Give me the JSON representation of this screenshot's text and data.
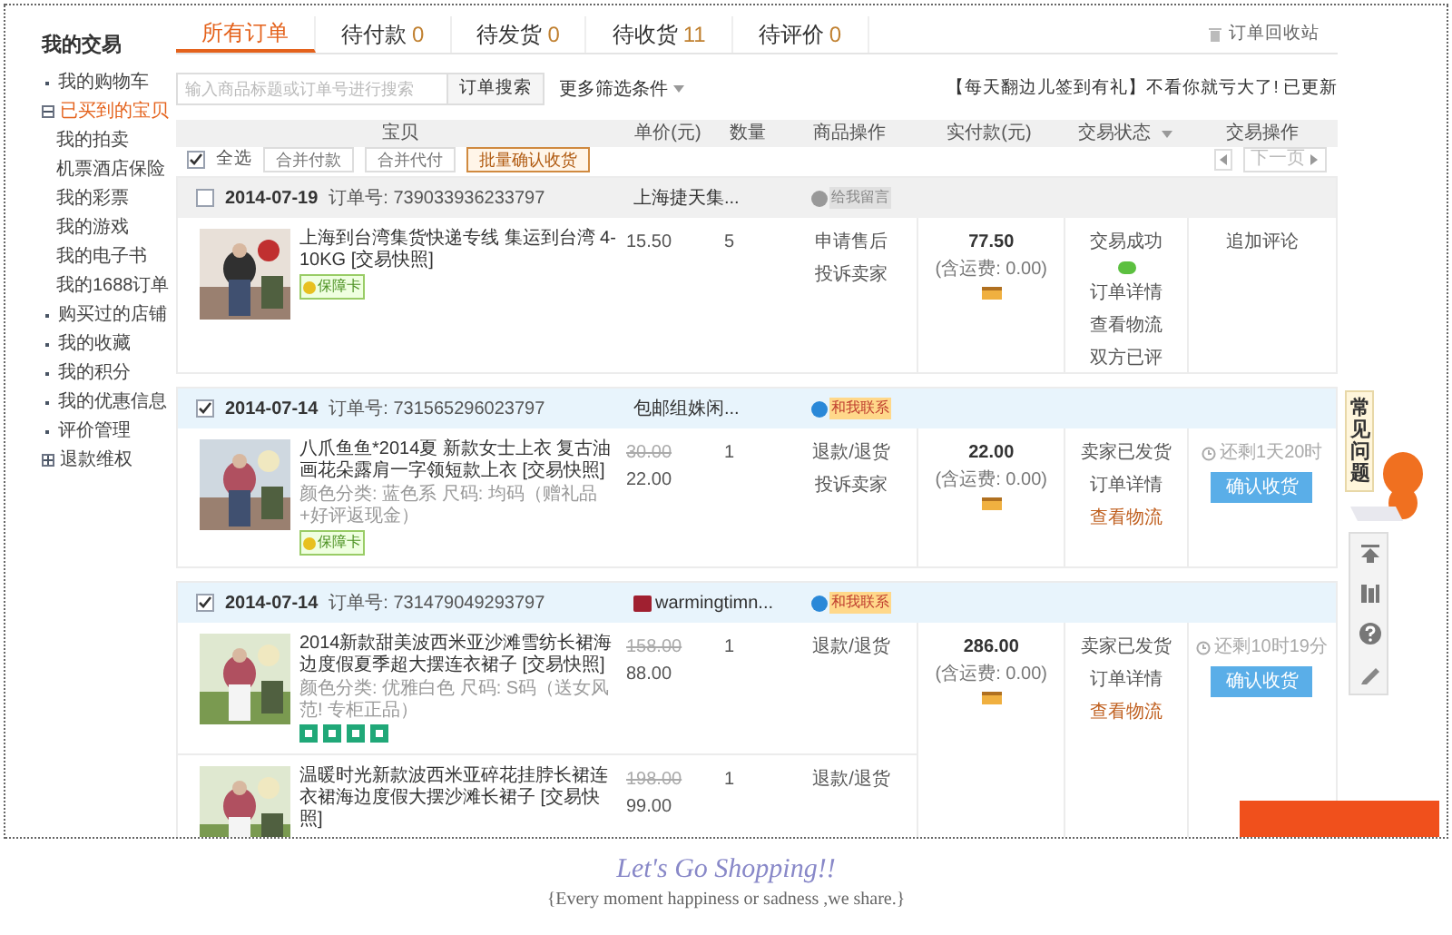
{
  "sidebar": {
    "title": "我的交易",
    "items": [
      {
        "label": "我的购物车",
        "selected": false
      },
      {
        "label": "已买到的宝贝",
        "selected": true,
        "expanded": true,
        "children": [
          {
            "label": "我的拍卖",
            "selected": false
          },
          {
            "label": "机票酒店保险",
            "selected": false
          },
          {
            "label": "我的彩票",
            "selected": false
          },
          {
            "label": "我的游戏",
            "selected": false
          },
          {
            "label": "我的电子书",
            "selected": false
          },
          {
            "label": "我的1688订单",
            "selected": false
          }
        ]
      },
      {
        "label": "购买过的店铺",
        "selected": false
      },
      {
        "label": "我的收藏",
        "selected": false
      },
      {
        "label": "我的积分",
        "selected": false
      },
      {
        "label": "我的优惠信息",
        "selected": false
      },
      {
        "label": "评价管理",
        "selected": false
      },
      {
        "label": "退款维权",
        "selected": false,
        "expanded": false
      }
    ]
  },
  "tabs": [
    {
      "label": "所有订单",
      "selected": true
    },
    {
      "label": "待付款",
      "count": "0",
      "selected": false
    },
    {
      "label": "待发货",
      "count": "0",
      "selected": false
    },
    {
      "label": "待收货",
      "count": "11",
      "selected": false
    },
    {
      "label": "待评价",
      "count": "0",
      "selected": false
    }
  ],
  "recycle_link": "订单回收站",
  "search": {
    "placeholder": "输入商品标题或订单号进行搜索",
    "button": "订单搜索",
    "filter": "更多筛选条件"
  },
  "notice": "【每天翻边儿签到有礼】不看你就亏大了! 已更新",
  "columns": [
    "宝贝",
    "单价(元)",
    "数量",
    "商品操作",
    "实付款(元)",
    "交易状态",
    "交易操作"
  ],
  "toolbar": {
    "select_all": {
      "label": "全选",
      "checked": true
    },
    "buttons": [
      {
        "label": "合并付款",
        "kind": "plain"
      },
      {
        "label": "合并代付",
        "kind": "plain"
      },
      {
        "label": "批量确认收货",
        "kind": "accent"
      }
    ],
    "next_page": "下一页"
  },
  "orders": [
    {
      "checked": false,
      "date": "2014-07-19",
      "order_no": "订单号: 739033936233797",
      "shop": "上海捷天集...",
      "shop_icon": false,
      "badge": {
        "kind": "message",
        "text": "给我留言"
      },
      "paid": "77.50",
      "freight": "(含运费: 0.00)",
      "chat": true,
      "status": [
        {
          "text": "交易成功",
          "highlight": false
        },
        {
          "text": "订单详情",
          "highlight": false
        },
        {
          "text": "查看物流",
          "highlight": false
        },
        {
          "text": "双方已评",
          "highlight": false
        }
      ],
      "action": {
        "kind": "review",
        "link": "追加评论"
      },
      "items": [
        {
          "title": "上海到台湾集货快递专线 集运到台湾 4-10KG [交易快照]",
          "guarantee": "保障卡",
          "service_icons": false,
          "price": "15.50",
          "qty": "5",
          "ops": [
            "申请售后",
            "投诉卖家"
          ]
        }
      ]
    },
    {
      "checked": true,
      "date": "2014-07-14",
      "order_no": "订单号: 731565296023797",
      "shop": "包邮组姝闲...",
      "shop_icon": false,
      "badge": {
        "kind": "contact",
        "text": "和我联系"
      },
      "paid": "22.00",
      "freight": "(含运费: 0.00)",
      "chat": false,
      "status": [
        {
          "text": "卖家已发货",
          "highlight": false
        },
        {
          "text": "订单详情",
          "highlight": false
        },
        {
          "text": "查看物流",
          "highlight": true
        }
      ],
      "action": {
        "kind": "confirm",
        "countdown": "还剩1天20时",
        "button": "确认收货"
      },
      "items": [
        {
          "title": "八爪鱼鱼*2014夏 新款女士上衣 复古油画花朵露肩一字领短款上衣 [交易快照]",
          "spec": "颜色分类: 蓝色系 尺码: 均码（赠礼品+好评返现金）",
          "guarantee": "保障卡",
          "service_icons": false,
          "original": "30.00",
          "price": "22.00",
          "qty": "1",
          "ops": [
            "退款/退货",
            "投诉卖家"
          ]
        }
      ]
    },
    {
      "checked": true,
      "date": "2014-07-14",
      "order_no": "订单号: 731479049293797",
      "shop": "warmingtimn...",
      "shop_icon": true,
      "badge": {
        "kind": "contact",
        "text": "和我联系"
      },
      "paid": "286.00",
      "freight": "(含运费: 0.00)",
      "chat": false,
      "status": [
        {
          "text": "卖家已发货",
          "highlight": false
        },
        {
          "text": "订单详情",
          "highlight": false
        },
        {
          "text": "查看物流",
          "highlight": true
        }
      ],
      "action": {
        "kind": "confirm",
        "countdown": "还剩10时19分",
        "button": "确认收货"
      },
      "items": [
        {
          "title": "2014新款甜美波西米亚沙滩雪纺长裙海边度假夏季超大摆连衣裙子 [交易快照]",
          "spec": "颜色分类: 优雅白色 尺码: S码（送女风范! 专柜正品）",
          "service_icons": true,
          "original": "158.00",
          "price": "88.00",
          "qty": "1",
          "ops": [
            "退款/退货"
          ]
        },
        {
          "title": "温暖时光新款波西米亚碎花挂脖长裙连衣裙海边度假大摆沙滩长裙子 [交易快照]",
          "service_icons": false,
          "original": "198.00",
          "price": "99.00",
          "qty": "1",
          "ops": [
            "退款/退货"
          ]
        }
      ]
    }
  ],
  "help_tab": "常见问题",
  "footer": {
    "slogan": "Let's Go Shopping!!",
    "tagline": "{Every moment happiness or sadness ,we share.}"
  }
}
